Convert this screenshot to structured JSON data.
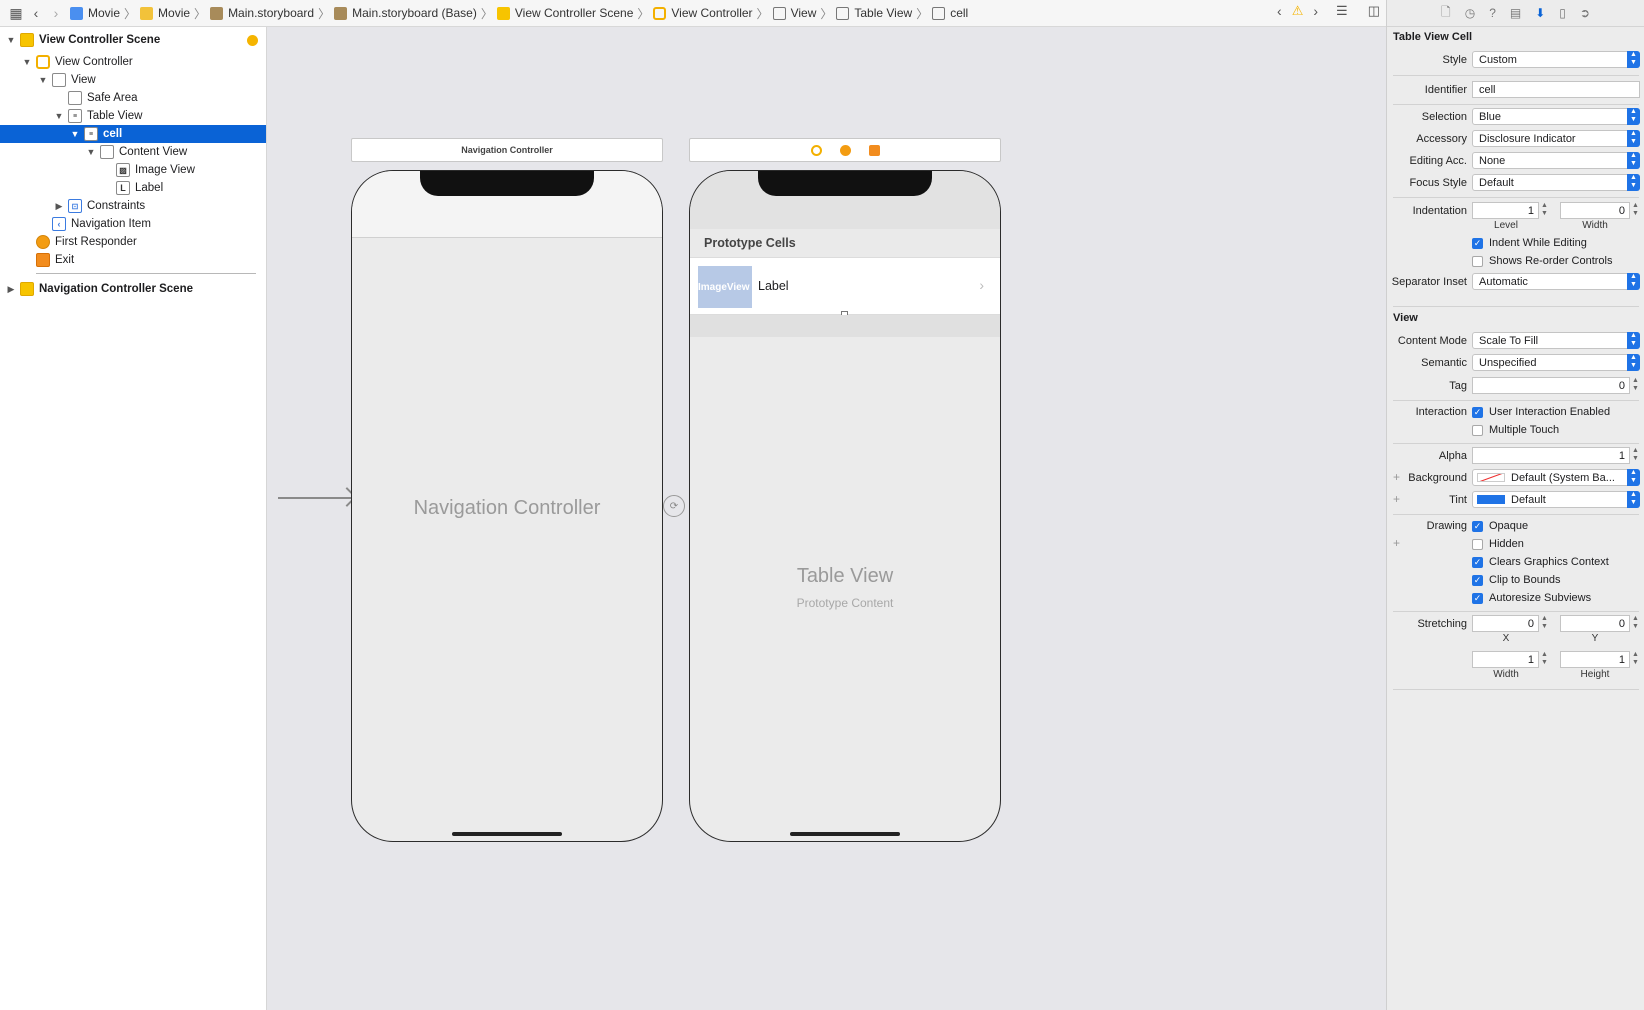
{
  "jumpbar": {
    "crumbs": [
      "Movie",
      "Movie",
      "Main.storyboard",
      "Main.storyboard (Base)",
      "View Controller Scene",
      "View Controller",
      "View",
      "Table View",
      "cell"
    ]
  },
  "navigator": {
    "items": [
      {
        "label": "View Controller Scene"
      },
      {
        "label": "View Controller"
      },
      {
        "label": "View"
      },
      {
        "label": "Safe Area"
      },
      {
        "label": "Table View"
      },
      {
        "label": "cell"
      },
      {
        "label": "Content View"
      },
      {
        "label": "Image View"
      },
      {
        "label": "Label"
      },
      {
        "label": "Constraints"
      },
      {
        "label": "Navigation Item"
      },
      {
        "label": "First Responder"
      },
      {
        "label": "Exit"
      },
      {
        "label": "Navigation Controller Scene"
      }
    ],
    "label_icon_letter": "L"
  },
  "canvas": {
    "nav_scene_title": "Navigation Controller",
    "nav_phone_title": "Navigation Controller",
    "prototype_header": "Prototype Cells",
    "cell_image_placeholder": "ImageView",
    "cell_label": "Label",
    "table_view_title": "Table View",
    "table_view_subtitle": "Prototype Content"
  },
  "inspector": {
    "section_cell": "Table View Cell",
    "style": {
      "label": "Style",
      "value": "Custom"
    },
    "identifier": {
      "label": "Identifier",
      "value": "cell"
    },
    "selection": {
      "label": "Selection",
      "value": "Blue"
    },
    "accessory": {
      "label": "Accessory",
      "value": "Disclosure Indicator"
    },
    "editing_acc": {
      "label": "Editing Acc.",
      "value": "None"
    },
    "focus_style": {
      "label": "Focus Style",
      "value": "Default"
    },
    "indentation": {
      "label": "Indentation",
      "level": "1",
      "width": "0",
      "level_label": "Level",
      "width_label": "Width"
    },
    "indent_while_editing": "Indent While Editing",
    "shows_reorder": "Shows Re-order Controls",
    "separator_inset": {
      "label": "Separator Inset",
      "value": "Automatic"
    },
    "section_view": "View",
    "content_mode": {
      "label": "Content Mode",
      "value": "Scale To Fill"
    },
    "semantic": {
      "label": "Semantic",
      "value": "Unspecified"
    },
    "tag": {
      "label": "Tag",
      "value": "0"
    },
    "interaction": {
      "label": "Interaction",
      "opt1": "User Interaction Enabled",
      "opt2": "Multiple Touch"
    },
    "alpha": {
      "label": "Alpha",
      "value": "1"
    },
    "background": {
      "label": "Background",
      "value": "Default (System Ba..."
    },
    "tint": {
      "label": "Tint",
      "value": "Default"
    },
    "drawing": {
      "label": "Drawing",
      "opaque": "Opaque",
      "hidden": "Hidden",
      "clears": "Clears Graphics Context",
      "clip": "Clip to Bounds",
      "autoresize": "Autoresize Subviews"
    },
    "stretching": {
      "label": "Stretching",
      "x": "0",
      "y": "0",
      "w": "1",
      "h": "1",
      "x_label": "X",
      "y_label": "Y",
      "w_label": "Width",
      "h_label": "Height"
    }
  },
  "colors": {
    "accent": "#0a63d6",
    "vc_icon": "#f3b000"
  }
}
